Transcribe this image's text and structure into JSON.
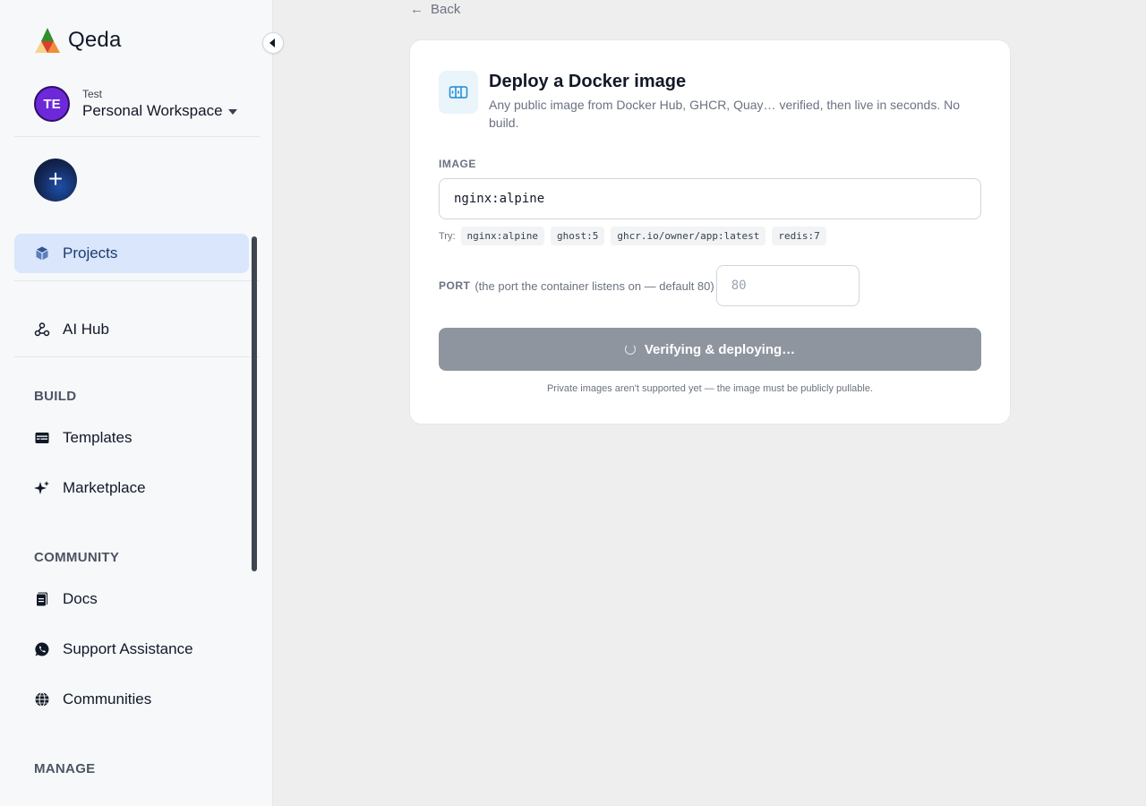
{
  "sidebar": {
    "brand": "Qeda",
    "workspace": {
      "avatar_initials": "TE",
      "subtitle": "Test",
      "name": "Personal Workspace"
    },
    "new_button": "+",
    "items": [
      {
        "label": "Projects",
        "icon": "cube-icon",
        "active": true
      },
      {
        "label": "AI Hub",
        "icon": "webhook-icon"
      }
    ],
    "sections": [
      {
        "label": "BUILD",
        "items": [
          {
            "label": "Templates",
            "icon": "template-icon"
          },
          {
            "label": "Marketplace",
            "icon": "sparkle-icon"
          }
        ]
      },
      {
        "label": "COMMUNITY",
        "items": [
          {
            "label": "Docs",
            "icon": "docs-icon"
          },
          {
            "label": "Support Assistance",
            "icon": "whatsapp-icon"
          },
          {
            "label": "Communities",
            "icon": "globe-icon"
          }
        ]
      },
      {
        "label": "MANAGE",
        "items": []
      }
    ]
  },
  "main": {
    "back_label": "Back",
    "card": {
      "title": "Deploy a Docker image",
      "description": "Any public image from Docker Hub, GHCR, Quay… verified, then live in seconds. No build.",
      "image_label": "IMAGE",
      "image_value": "nginx:alpine",
      "try_label": "Try:",
      "suggestions": [
        "nginx:alpine",
        "ghost:5",
        "ghcr.io/owner/app:latest",
        "redis:7"
      ],
      "port_label": "PORT",
      "port_hint": "(the port the container listens on — default 80)",
      "port_placeholder": "80",
      "deploy_label": "Verifying & deploying…",
      "footnote": "Private images aren't supported yet — the image must be publicly pullable."
    }
  },
  "colors": {
    "accent": "#d9e6fb",
    "avatar": "#6d28d9",
    "button_disabled": "#8f959e"
  }
}
